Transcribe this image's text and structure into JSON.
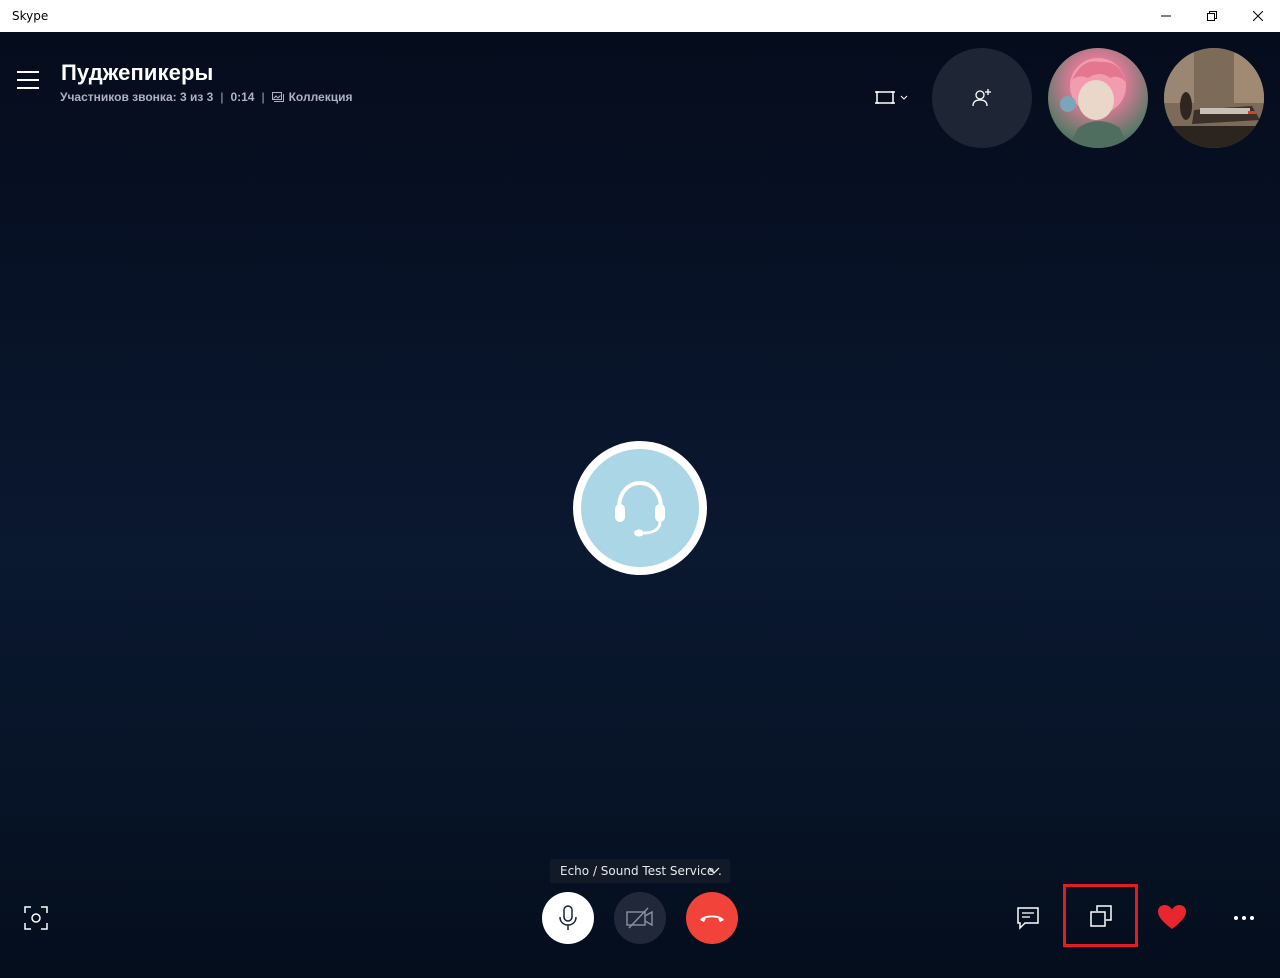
{
  "window": {
    "title": "Skype"
  },
  "call": {
    "title": "Пуджепикеры",
    "participants_text": "Участников звонка: 3 из 3",
    "duration": "0:14",
    "separator": "|",
    "gallery_label": "Коллекция"
  },
  "devices": {
    "current_device": "Echo / Sound Test Service ."
  },
  "colors": {
    "background": "#071427",
    "hangup": "#f2433b",
    "highlight_box": "#e01e22",
    "reaction_heart": "#e8262d",
    "center_avatar": "#aad6e6"
  },
  "icons": {
    "menu": "hamburger-icon",
    "layout": "layout-icon",
    "add_person": "add-person-icon",
    "center": "headset-icon",
    "screenshot": "screenshot-icon",
    "mic": "microphone-icon",
    "video": "video-off-icon",
    "hangup": "hang-up-icon",
    "chat": "chat-icon",
    "switch": "switch-view-icon",
    "react": "heart-icon",
    "more": "more-icon"
  }
}
